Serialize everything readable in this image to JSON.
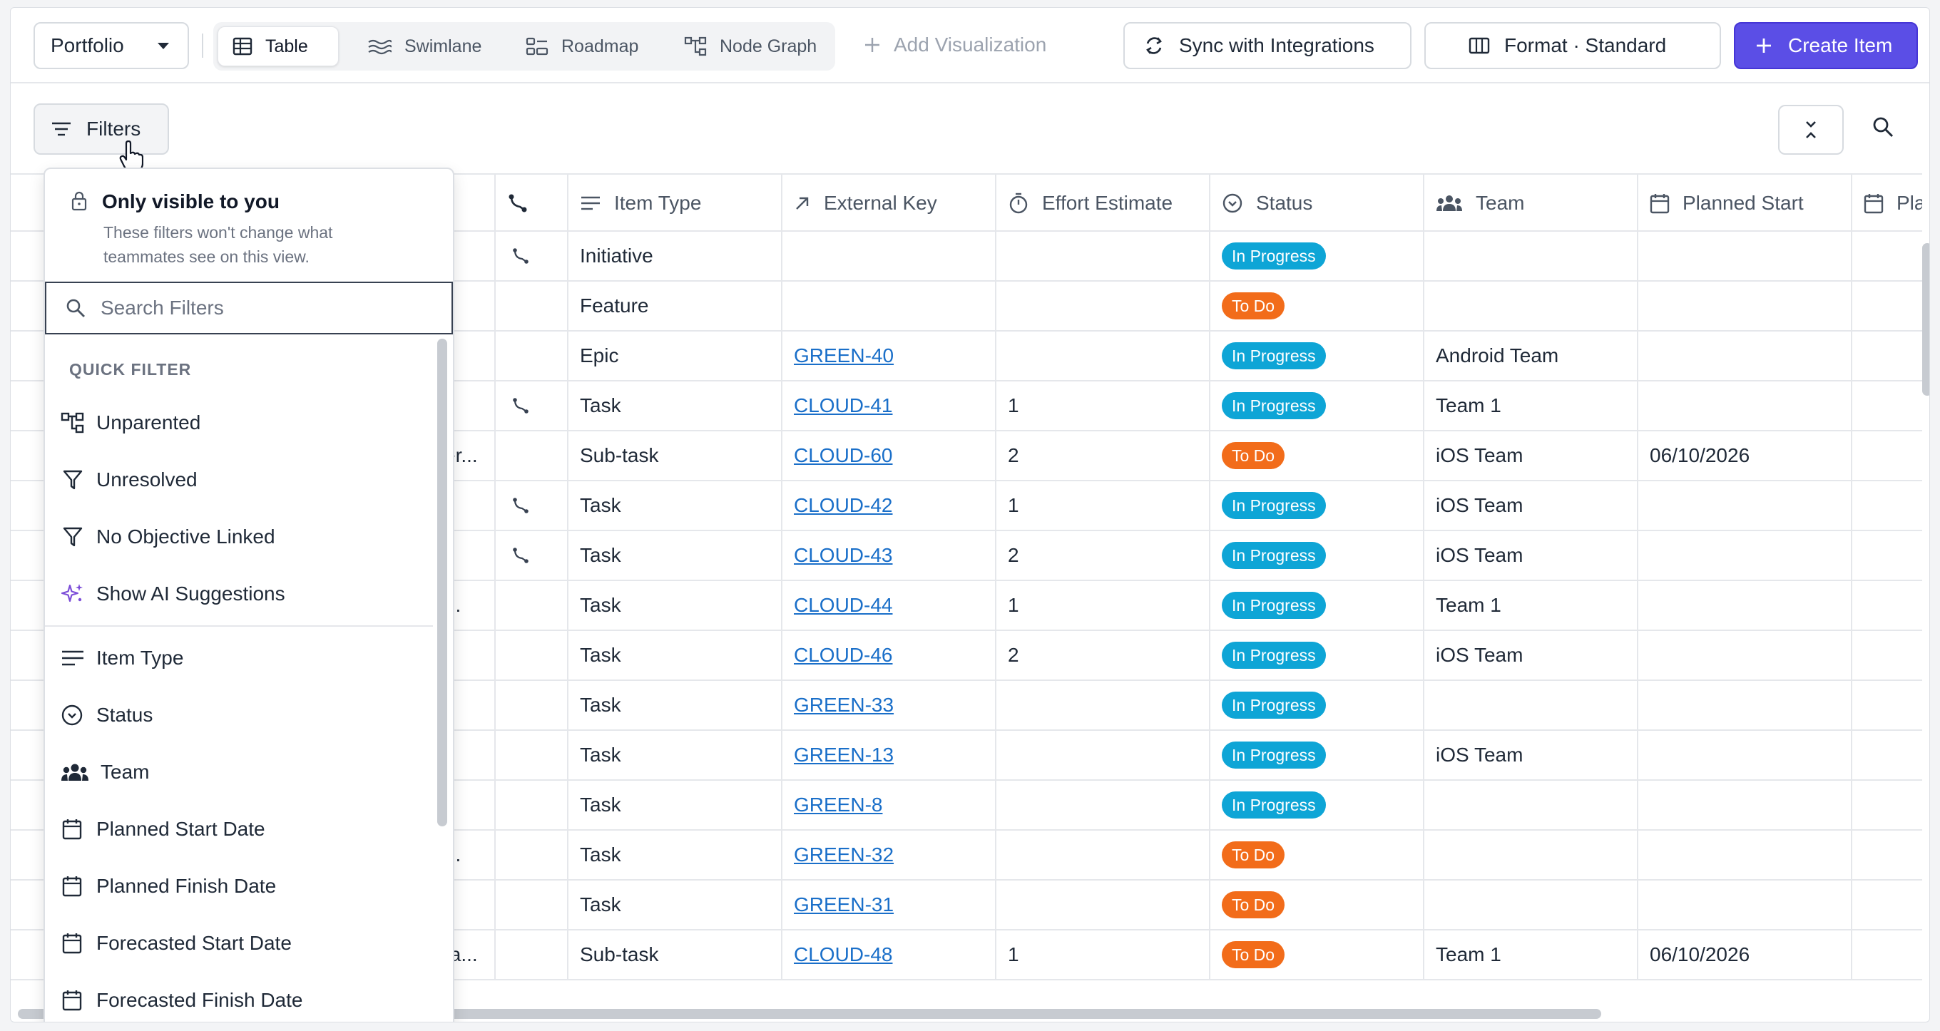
{
  "toolbar": {
    "portfolio_label": "Portfolio",
    "views": [
      {
        "label": "Table",
        "icon": "table-icon",
        "active": true
      },
      {
        "label": "Swimlane",
        "icon": "swimlane-icon",
        "active": false
      },
      {
        "label": "Roadmap",
        "icon": "roadmap-icon",
        "active": false
      },
      {
        "label": "Node Graph",
        "icon": "node-graph-icon",
        "active": false
      }
    ],
    "add_visualization": "Add Visualization",
    "sync_label": "Sync with Integrations",
    "format_label": "Format · Standard",
    "create_label": "Create Item",
    "accent_color": "#5b4ee6"
  },
  "filterbar": {
    "filters_label": "Filters"
  },
  "table": {
    "columns": [
      "",
      "Item Type",
      "External Key",
      "Effort Estimate",
      "Status",
      "Team",
      "Planned Start",
      "Pla"
    ],
    "rows": [
      {
        "lead": "",
        "link": true,
        "type": "Initiative",
        "key": "",
        "effort": "",
        "status": "In Progress",
        "team": "",
        "start": ""
      },
      {
        "lead": "",
        "link": false,
        "type": "Feature",
        "key": "",
        "effort": "",
        "status": "To Do",
        "team": "",
        "start": ""
      },
      {
        "lead": "..",
        "link": false,
        "type": "Epic",
        "key": "GREEN-40",
        "effort": "",
        "status": "In Progress",
        "team": "Android Team",
        "start": ""
      },
      {
        "lead": "..",
        "link": true,
        "type": "Task",
        "key": "CLOUD-41",
        "effort": "1",
        "status": "In Progress",
        "team": "Team 1",
        "start": ""
      },
      {
        "lead": "er...",
        "link": false,
        "type": "Sub-task",
        "key": "CLOUD-60",
        "effort": "2",
        "status": "To Do",
        "team": "iOS Team",
        "start": "06/10/2026"
      },
      {
        "lead": "..",
        "link": true,
        "type": "Task",
        "key": "CLOUD-42",
        "effort": "1",
        "status": "In Progress",
        "team": "iOS Team",
        "start": ""
      },
      {
        "lead": "..",
        "link": true,
        "type": "Task",
        "key": "CLOUD-43",
        "effort": "2",
        "status": "In Progress",
        "team": "iOS Team",
        "start": ""
      },
      {
        "lead": "...",
        "link": false,
        "type": "Task",
        "key": "CLOUD-44",
        "effort": "1",
        "status": "In Progress",
        "team": "Team 1",
        "start": ""
      },
      {
        "lead": "..",
        "link": false,
        "type": "Task",
        "key": "CLOUD-46",
        "effort": "2",
        "status": "In Progress",
        "team": "iOS Team",
        "start": ""
      },
      {
        "lead": "..",
        "link": false,
        "type": "Task",
        "key": "GREEN-33",
        "effort": "",
        "status": "In Progress",
        "team": "",
        "start": ""
      },
      {
        "lead": "..",
        "link": false,
        "type": "Task",
        "key": "GREEN-13",
        "effort": "",
        "status": "In Progress",
        "team": "iOS Team",
        "start": ""
      },
      {
        "lead": "..",
        "link": false,
        "type": "Task",
        "key": "GREEN-8",
        "effort": "",
        "status": "In Progress",
        "team": "",
        "start": ""
      },
      {
        "lead": "...",
        "link": false,
        "type": "Task",
        "key": "GREEN-32",
        "effort": "",
        "status": "To Do",
        "team": "",
        "start": ""
      },
      {
        "lead": "..",
        "link": false,
        "type": "Task",
        "key": "GREEN-31",
        "effort": "",
        "status": "To Do",
        "team": "",
        "start": ""
      },
      {
        "lead": "ta...",
        "link": false,
        "type": "Sub-task",
        "key": "CLOUD-48",
        "effort": "1",
        "status": "To Do",
        "team": "Team 1",
        "start": "06/10/2026"
      }
    ],
    "status_colors": {
      "In Progress": "#0ea5d6",
      "To Do": "#f26c1a"
    }
  },
  "filter_panel": {
    "title": "Only visible to you",
    "subtitle": "These filters won't change what teammates see on this view.",
    "search_placeholder": "Search Filters",
    "section_label": "QUICK FILTER",
    "quick_filters": [
      {
        "label": "Unparented",
        "icon": "hierarchy-icon"
      },
      {
        "label": "Unresolved",
        "icon": "funnel-icon"
      },
      {
        "label": "No Objective Linked",
        "icon": "funnel-icon"
      },
      {
        "label": "Show AI Suggestions",
        "icon": "sparkle-icon"
      }
    ],
    "fields": [
      {
        "label": "Item Type",
        "icon": "lines-icon"
      },
      {
        "label": "Status",
        "icon": "status-icon"
      },
      {
        "label": "Team",
        "icon": "team-icon"
      },
      {
        "label": "Planned Start Date",
        "icon": "calendar-icon"
      },
      {
        "label": "Planned Finish Date",
        "icon": "calendar-icon"
      },
      {
        "label": "Forecasted Start Date",
        "icon": "calendar-icon"
      },
      {
        "label": "Forecasted Finish Date",
        "icon": "calendar-icon"
      }
    ]
  }
}
